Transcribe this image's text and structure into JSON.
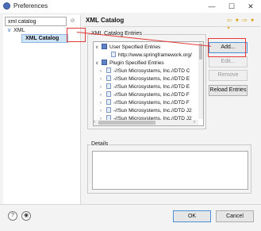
{
  "window": {
    "title": "Preferences",
    "minimize": "—",
    "maximize": "☐",
    "close": "✕"
  },
  "filter": {
    "value": "xml catalog",
    "clear_glyph": "⊘"
  },
  "tree": {
    "xml_label": "XML",
    "xml_chevron": "∨",
    "catalog_label": "XML Catalog"
  },
  "page": {
    "title": "XML Catalog",
    "nav_glyph": "⇦ ▾ ⇨ ▾ ▾"
  },
  "entries": {
    "group_label": "XML Catalog Entries",
    "rows": [
      {
        "kind": "folder",
        "twisty": "∨",
        "label": "User Specified Entries"
      },
      {
        "kind": "entry",
        "twisty": "",
        "label": "http://www.springframework.org/"
      },
      {
        "kind": "folder",
        "twisty": "∨",
        "label": "Plugin Specified Entries"
      },
      {
        "kind": "entry",
        "twisty": "›",
        "label": "-//Sun Microsystems, Inc.//DTD C"
      },
      {
        "kind": "entry",
        "twisty": "›",
        "label": "-//Sun Microsystems, Inc.//DTD E"
      },
      {
        "kind": "entry",
        "twisty": "›",
        "label": "-//Sun Microsystems, Inc.//DTD E"
      },
      {
        "kind": "entry",
        "twisty": "›",
        "label": "-//Sun Microsystems, Inc.//DTD F"
      },
      {
        "kind": "entry",
        "twisty": "›",
        "label": "-//Sun Microsystems, Inc.//DTD F"
      },
      {
        "kind": "entry",
        "twisty": "›",
        "label": "-//Sun Microsystems, Inc.//DTD J2"
      },
      {
        "kind": "entry",
        "twisty": "›",
        "label": "-//Sun Microsystems, Inc.//DTD J2"
      }
    ]
  },
  "buttons": {
    "add": "Add...",
    "edit": "Edit...",
    "remove": "Remove",
    "reload": "Reload Entries"
  },
  "details": {
    "label": "Details"
  },
  "footer": {
    "help_glyph": "?",
    "import_glyph": "◉",
    "ok": "OK",
    "cancel": "Cancel"
  },
  "colors": {
    "accent": "#e53935",
    "selection": "#cfe3f7"
  }
}
